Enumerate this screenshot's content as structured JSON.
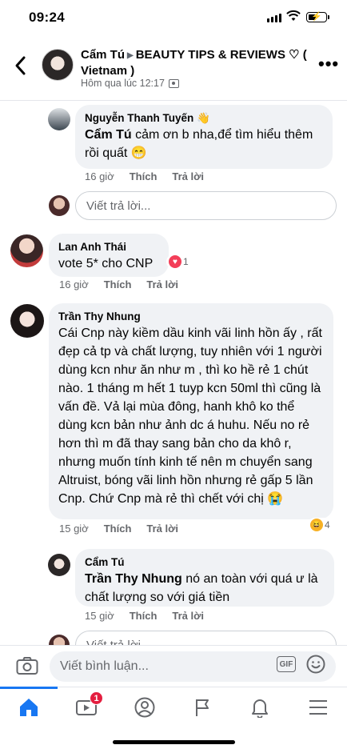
{
  "status": {
    "time": "09:24"
  },
  "header": {
    "author": "Cẩm Tú",
    "group": "BEAUTY TIPS & REVIEWS ♡ ( Vietnam )",
    "timestamp": "Hôm qua lúc 12:17"
  },
  "comments": [
    {
      "name": "Nguyễn Thanh Tuyến 👋",
      "mention": "Cẩm Tú",
      "text": " cảm ơn b nha,để tìm hiểu thêm rồi quất 😁",
      "time": "16 giờ",
      "like": "Thích",
      "reply": "Trả lời"
    },
    {
      "reply_placeholder": "Viết trả lời..."
    },
    {
      "name": "Lan Anh Thái",
      "text": "vote 5* cho CNP",
      "time": "16 giờ",
      "like": "Thích",
      "reply": "Trả lời",
      "reactions": "1"
    },
    {
      "name": "Trần Thy Nhung",
      "text": "Cái Cnp này kiềm dầu kinh vãi linh hồn ấy , rất đẹp cả tp và chất lượng, tuy nhiên với 1 người dùng kcn như ăn như m , thì ko hề rẻ 1 chút nào. 1 tháng m hết 1 tuyp kcn 50ml thì cũng là vấn đề. Vả lại mùa đông, hanh khô ko thể dùng kcn bản như ảnh dc á huhu. Nếu no rẻ hơn thì m đã thay sang bản cho da khô r, nhưng muốn tính kinh tế nên m chuyển sang Altruist, bóng vãi linh hồn nhưng rẻ gấp 5 lần Cnp. Chứ Cnp mà rẻ thì chết với chị 😭",
      "time": "15 giờ",
      "like": "Thích",
      "reply": "Trả lời",
      "reactions": "4"
    },
    {
      "name": "Cẩm Tú",
      "mention": "Trần Thy Nhung",
      "text": " nó an toàn với quá ư là chất lượng so với giá tiền",
      "time": "15 giờ",
      "like": "Thích",
      "reply": "Trả lời"
    },
    {
      "reply_placeholder": "Viết trả lời..."
    }
  ],
  "composer": {
    "placeholder": "Viết bình luận...",
    "gif": "GIF"
  },
  "tabs": {
    "video_badge": "1"
  },
  "colors": {
    "accent": "#1877f2",
    "bubble": "#f0f2f5",
    "badge": "#e41e3f"
  }
}
